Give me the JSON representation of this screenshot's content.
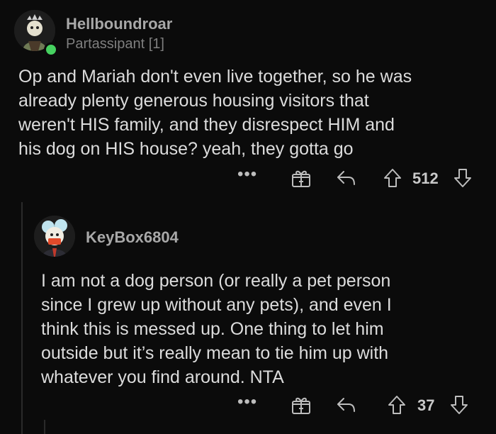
{
  "comments": [
    {
      "username": "Hellboundroar",
      "flair": "Partassipant [1]",
      "text": "Op and Mariah don't even live together, so he was\nalready plenty generous housing visitors that\nweren't HIS family, and they disrespect HIM and\nhis dog on HIS house? yeah, they gotta go",
      "votes": "512",
      "more": "•••",
      "avatar_icon": "user-avatar-icon",
      "online_status": "online"
    },
    {
      "username": "KeyBox6804",
      "text": "I am not a dog person (or really a pet person\nsince I grew up without any pets), and even I\nthink this is messed up. One thing to let him\noutside but it’s really mean to tie him up with\nwhatever you find around. NTA",
      "votes": "37",
      "more": "•••",
      "avatar_icon": "user-avatar-icon"
    }
  ],
  "icons": {
    "award": "gift-icon",
    "reply": "reply-icon",
    "upvote": "upvote-icon",
    "downvote": "downvote-icon"
  },
  "colors": {
    "background": "#0b0b0b",
    "online": "#46d160"
  }
}
